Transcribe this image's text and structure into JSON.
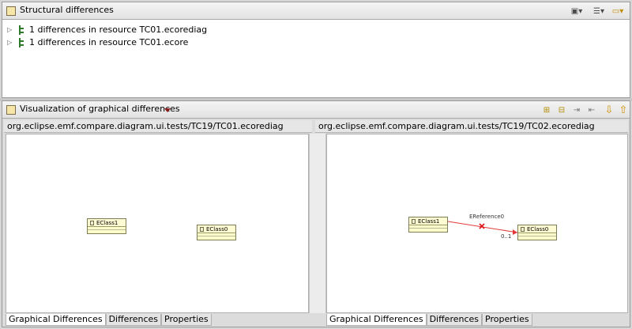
{
  "structural": {
    "title": "Structural differences",
    "items": [
      {
        "label": "1 differences in resource TC01.ecorediag"
      },
      {
        "label": "1 differences in resource TC01.ecore"
      }
    ]
  },
  "visualization": {
    "title": "Visualization of graphical differences",
    "left": {
      "path": "org.eclipse.emf.compare.diagram.ui.tests/TC19/TC01.ecorediag",
      "classes": [
        {
          "name": "EClass1"
        },
        {
          "name": "EClass0"
        }
      ]
    },
    "right": {
      "path": "org.eclipse.emf.compare.diagram.ui.tests/TC19/TC02.ecorediag",
      "classes": [
        {
          "name": "EClass1"
        },
        {
          "name": "EClass0"
        }
      ],
      "reference": {
        "name": "EReference0",
        "multiplicity": "0..1"
      }
    },
    "tabs": [
      "Graphical Differences",
      "Differences",
      "Properties"
    ]
  },
  "colors": {
    "reference_line": "#e23a3a",
    "class_fill": "#ffffcc"
  }
}
